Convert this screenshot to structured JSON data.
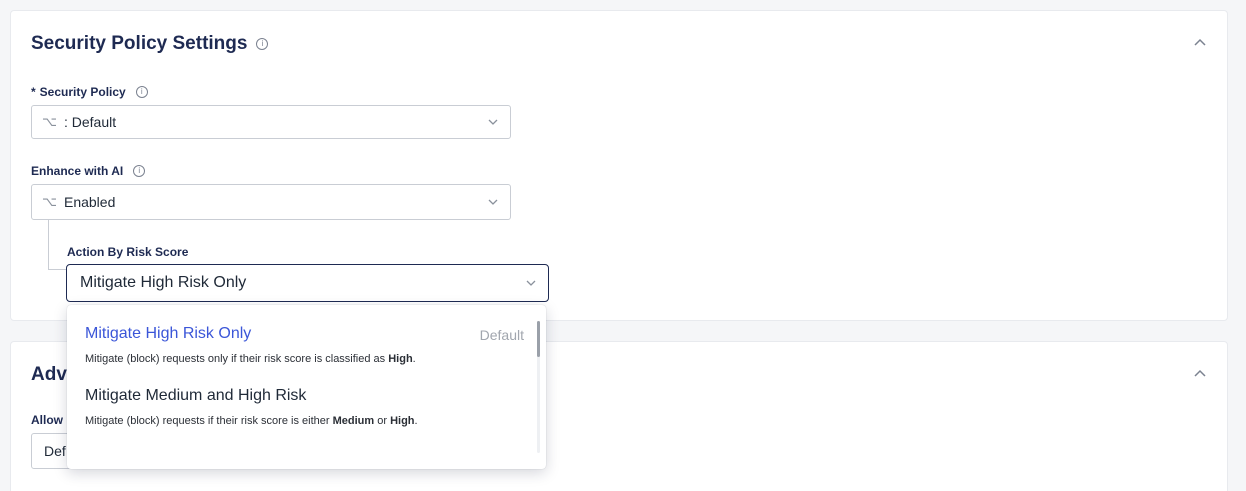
{
  "security_card": {
    "title": "Security Policy Settings",
    "security_policy": {
      "required_mark": "*",
      "label": "Security Policy",
      "value": ": Default"
    },
    "enhance_ai": {
      "label": "Enhance with AI",
      "value": "Enabled"
    },
    "action_by_risk": {
      "label": "Action By Risk Score",
      "value": "Mitigate High Risk Only"
    }
  },
  "dropdown": {
    "options": [
      {
        "title": "Mitigate High Risk Only",
        "tag": "Default",
        "desc_prefix": "Mitigate (block) requests only if their risk score is classified as ",
        "desc_bold_1": "High",
        "desc_suffix": "."
      },
      {
        "title": "Mitigate Medium and High Risk",
        "desc_prefix": "Mitigate (block) requests if their risk score is either ",
        "desc_bold_1": "Medium",
        "desc_mid": " or ",
        "desc_bold_2": "High",
        "desc_suffix": "."
      }
    ]
  },
  "advanced_card": {
    "title_visible": "Adv",
    "allow_label_visible": "Allow",
    "select_value_visible": "Def"
  },
  "icons": {
    "info": "info-icon",
    "collapse": "chevron-up-icon",
    "dropdown": "chevron-down-icon",
    "source": "source-branch-icon"
  },
  "colors": {
    "heading": "#1e2a52",
    "selected_option": "#3b56d8",
    "muted": "#a1a6ae",
    "border": "#c9cdd4"
  }
}
